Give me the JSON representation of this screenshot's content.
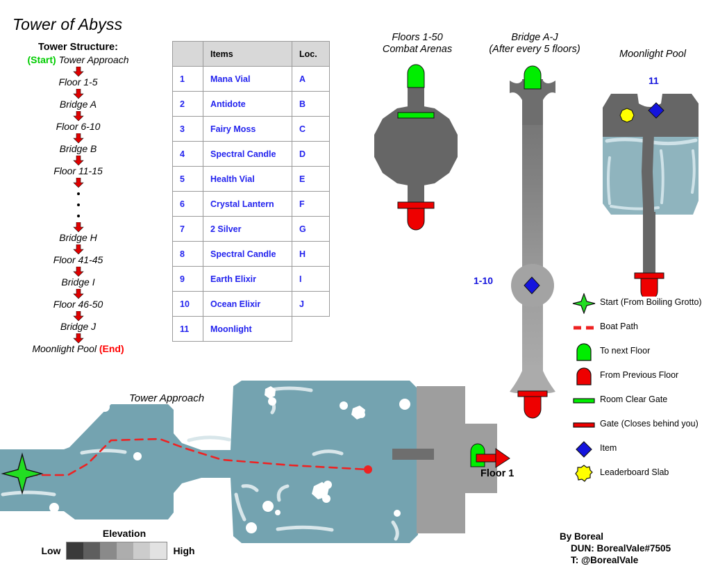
{
  "title": "Tower of Abyss",
  "tower_structure": {
    "heading": "Tower Structure:",
    "start_tag": "(Start)",
    "end_tag": "(End)",
    "rows": [
      {
        "label": "Tower Approach",
        "tag": "(Start)"
      },
      {
        "label": "Floor 1-5"
      },
      {
        "label": "Bridge A"
      },
      {
        "label": "Floor 6-10"
      },
      {
        "label": "Bridge B"
      },
      {
        "label": "Floor 11-15"
      },
      {
        "label": "Bridge H"
      },
      {
        "label": "Floor 41-45"
      },
      {
        "label": "Bridge I"
      },
      {
        "label": "Floor 46-50"
      },
      {
        "label": "Bridge J"
      },
      {
        "label": "Moonlight Pool",
        "tag": "(End)"
      }
    ]
  },
  "items_table": {
    "headers": [
      "",
      "Items",
      "Loc."
    ],
    "rows": [
      {
        "num": "1",
        "item": "Mana Vial",
        "loc": "A"
      },
      {
        "num": "2",
        "item": "Antidote",
        "loc": "B"
      },
      {
        "num": "3",
        "item": "Fairy Moss",
        "loc": "C"
      },
      {
        "num": "4",
        "item": "Spectral Candle",
        "loc": "D"
      },
      {
        "num": "5",
        "item": "Health Vial",
        "loc": "E"
      },
      {
        "num": "6",
        "item": "Crystal Lantern",
        "loc": "F"
      },
      {
        "num": "7",
        "item": "2 Silver",
        "loc": "G"
      },
      {
        "num": "8",
        "item": "Spectral Candle",
        "loc": "H"
      },
      {
        "num": "9",
        "item": "Earth Elixir",
        "loc": "I"
      },
      {
        "num": "10",
        "item": "Ocean Elixir",
        "loc": "J"
      },
      {
        "num": "11",
        "item": "Moonlight",
        "loc": ""
      }
    ]
  },
  "arena": {
    "caption_line1": "Floors 1-50",
    "caption_line2": "Combat Arenas"
  },
  "bridge": {
    "caption_line1": "Bridge A-J",
    "caption_line2": "(After every 5 floors)",
    "item_label": "1-10"
  },
  "pool": {
    "caption": "Moonlight Pool",
    "item_label": "11"
  },
  "approach": {
    "label": "Tower Approach",
    "floor_label": "Floor 1"
  },
  "elevation": {
    "title": "Elevation",
    "low": "Low",
    "high": "High",
    "swatches": [
      "#3a3a3a",
      "#5e5e5e",
      "#8a8a8a",
      "#adadad",
      "#cccccc",
      "#e2e2e2"
    ]
  },
  "legend": {
    "items": [
      {
        "icon": "green-four-point-star-icon",
        "label": "Start (From Boiling Grotto)"
      },
      {
        "icon": "red-dashed-line-icon",
        "label": "Boat Path"
      },
      {
        "icon": "green-arch-icon",
        "label": "To next Floor"
      },
      {
        "icon": "red-arch-icon",
        "label": "From Previous Floor"
      },
      {
        "icon": "green-gate-bar-icon",
        "label": "Room Clear Gate"
      },
      {
        "icon": "red-gate-bar-icon",
        "label": "Gate (Closes behind you)"
      },
      {
        "icon": "blue-diamond-icon",
        "label": "Item"
      },
      {
        "icon": "yellow-starburst-icon",
        "label": "Leaderboard Slab"
      }
    ]
  },
  "credits": {
    "line1": "By Boreal",
    "line2": "DUN: BorealVale#7505",
    "line3": "T: @BorealVale"
  },
  "colors": {
    "green": "#00ee00",
    "red": "#ee0000",
    "blue": "#1414dd",
    "yellow": "#ffff00",
    "water": "#74a3b0",
    "pool_water": "#8fb4be",
    "rock_gray": "#666666",
    "stone_gray": "#9e9e9e",
    "table_header": "#d8d8d8",
    "item_text": "#2222ee"
  }
}
